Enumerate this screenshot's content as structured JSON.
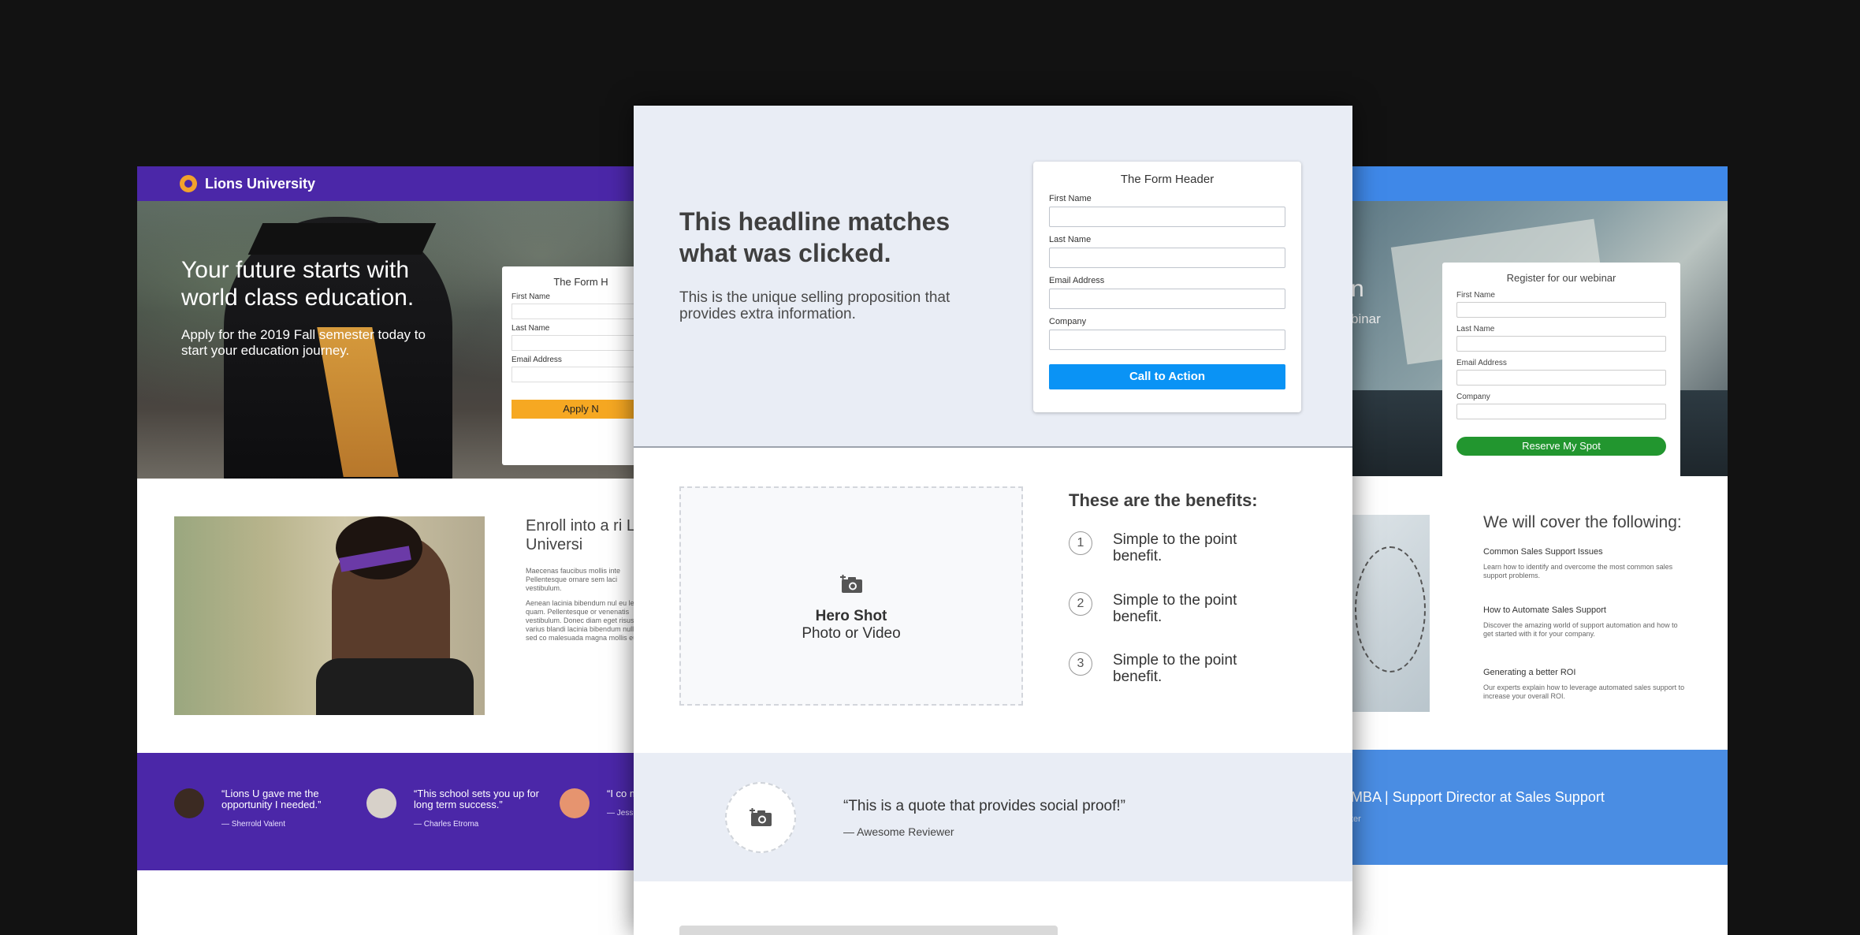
{
  "left_page": {
    "brand": "Lions University",
    "hero_title": "Your future starts with world class education.",
    "hero_subtitle": "Apply for the 2019 Fall semester today to start your education journey.",
    "form": {
      "header": "The Form H",
      "fields": [
        "First Name",
        "Last Name",
        "Email Address"
      ],
      "button": "Apply N"
    },
    "enroll_title": "Enroll into a ri Lions Universi",
    "lorem_1": "Maecenas faucibus mollis inte Pellentesque ornare sem laci vestibulum.",
    "lorem_2": "Aenean lacinia bibendum nul eu leo quam. Pellentesque or venenatis vestibulum. Donec diam eget risus varius blandi lacinia bibendum nulla sed co malesuada magna mollis eui",
    "testimonials": [
      {
        "quote": "“Lions U gave me the opportunity I needed.”",
        "name": "— Sherrold Valent"
      },
      {
        "quote": "“This school sets you up for long term success.”",
        "name": "— Charles Etroma"
      },
      {
        "quote": "“I co my d",
        "name": "— Jess"
      }
    ]
  },
  "center_page": {
    "headline": "This headline matches what was clicked.",
    "usp": "This is the unique selling proposition that provides extra information.",
    "form": {
      "header": "The Form Header",
      "fields": [
        "First Name",
        "Last Name",
        "Email Address",
        "Company"
      ],
      "button": "Call to Action"
    },
    "hero_shot": {
      "title": "Hero Shot",
      "subtitle": "Photo or Video",
      "icon": "camera-plus-icon"
    },
    "benefits_title": "These are the benefits:",
    "benefits": [
      {
        "num": "1",
        "text": "Simple to the point benefit."
      },
      {
        "num": "2",
        "text": "Simple to the point benefit."
      },
      {
        "num": "3",
        "text": "Simple to the point benefit."
      }
    ],
    "quote": "“This is a quote that provides social proof!”",
    "reviewer": "— Awesome Reviewer"
  },
  "right_page": {
    "hero_title_fragment": "n",
    "hero_subtitle_fragment": "binar",
    "form": {
      "header": "Register for our webinar",
      "fields": [
        "First Name",
        "Last Name",
        "Email Address",
        "Company"
      ],
      "button": "Reserve My Spot"
    },
    "cover_title": "We will cover the following:",
    "topics": [
      {
        "title": "Common Sales Support Issues",
        "desc": "Learn how to identify and overcome the most common sales support problems."
      },
      {
        "title": "How to Automate Sales Support",
        "desc": "Discover the amazing world of support automation and how to get started with it for your company."
      },
      {
        "title": "Generating a better ROI",
        "desc": "Our experts explain how to leverage automated sales support to increase your overall ROI."
      }
    ],
    "speaker_line": "MBA | Support Director at Sales Support",
    "speaker_sub": "ter"
  },
  "colors": {
    "lions_purple": "#4b27a8",
    "lions_cta": "#f6a822",
    "center_cta": "#0a93f5",
    "webinar_blue": "#3f88e8",
    "webinar_cta": "#22962f"
  }
}
